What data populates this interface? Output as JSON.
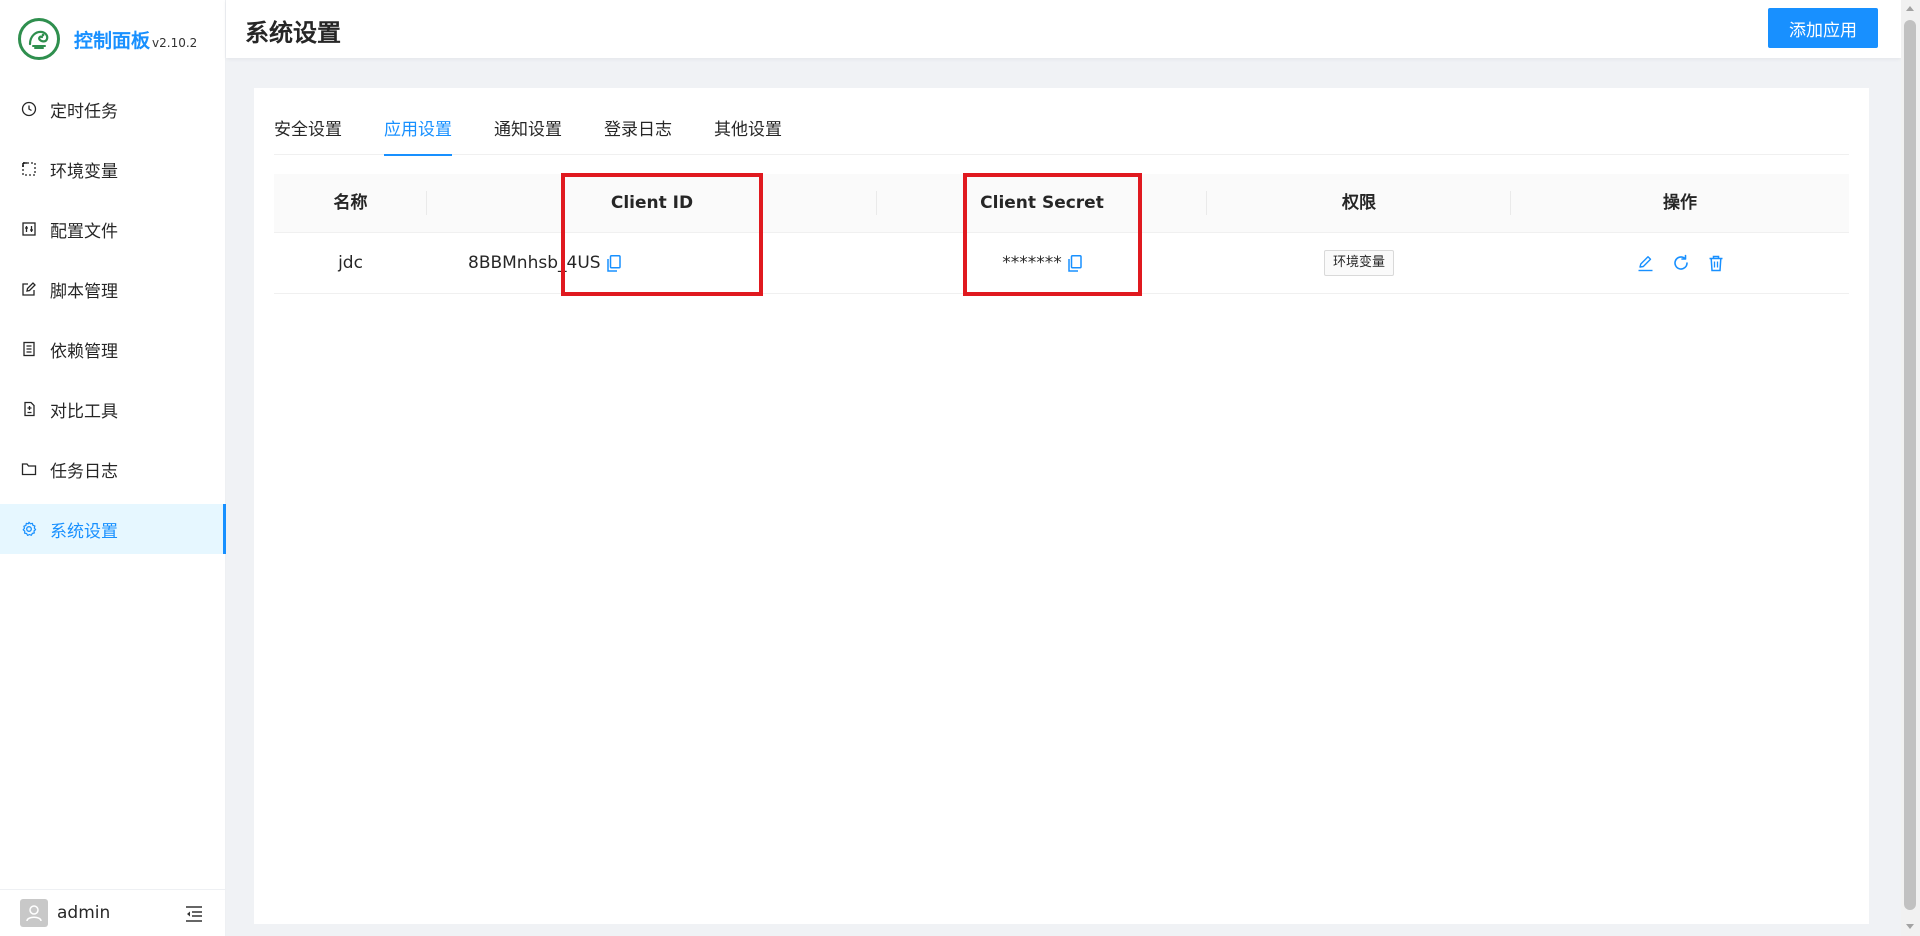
{
  "app": {
    "title": "控制面板",
    "version": "v2.10.2",
    "accent_color": "#1890ff"
  },
  "sidebar": {
    "items": [
      {
        "label": "定时任务",
        "icon": "clock-icon",
        "active": false
      },
      {
        "label": "环境变量",
        "icon": "dashed-box-icon",
        "active": false
      },
      {
        "label": "配置文件",
        "icon": "config-file-icon",
        "active": false
      },
      {
        "label": "脚本管理",
        "icon": "edit-icon",
        "active": false
      },
      {
        "label": "依赖管理",
        "icon": "container-icon",
        "active": false
      },
      {
        "label": "对比工具",
        "icon": "diff-icon",
        "active": false
      },
      {
        "label": "任务日志",
        "icon": "folder-icon",
        "active": false
      },
      {
        "label": "系统设置",
        "icon": "gear-icon",
        "active": true
      }
    ],
    "user": {
      "name": "admin",
      "avatar_icon": "user-icon"
    },
    "collapse_icon": "menu-fold-icon"
  },
  "header": {
    "title": "系统设置",
    "add_button_label": "添加应用"
  },
  "tabs": [
    {
      "label": "安全设置",
      "active": false
    },
    {
      "label": "应用设置",
      "active": true
    },
    {
      "label": "通知设置",
      "active": false
    },
    {
      "label": "登录日志",
      "active": false
    },
    {
      "label": "其他设置",
      "active": false
    }
  ],
  "table": {
    "columns": [
      "名称",
      "Client ID",
      "Client Secret",
      "权限",
      "操作"
    ],
    "rows": [
      {
        "name": "jdc",
        "client_id": "8BBMnhsb_4US",
        "client_secret": "*******",
        "permission": "环境变量",
        "actions": [
          "edit-icon",
          "reload-icon",
          "delete-icon"
        ]
      }
    ]
  },
  "highlight_color": "#e0191f"
}
